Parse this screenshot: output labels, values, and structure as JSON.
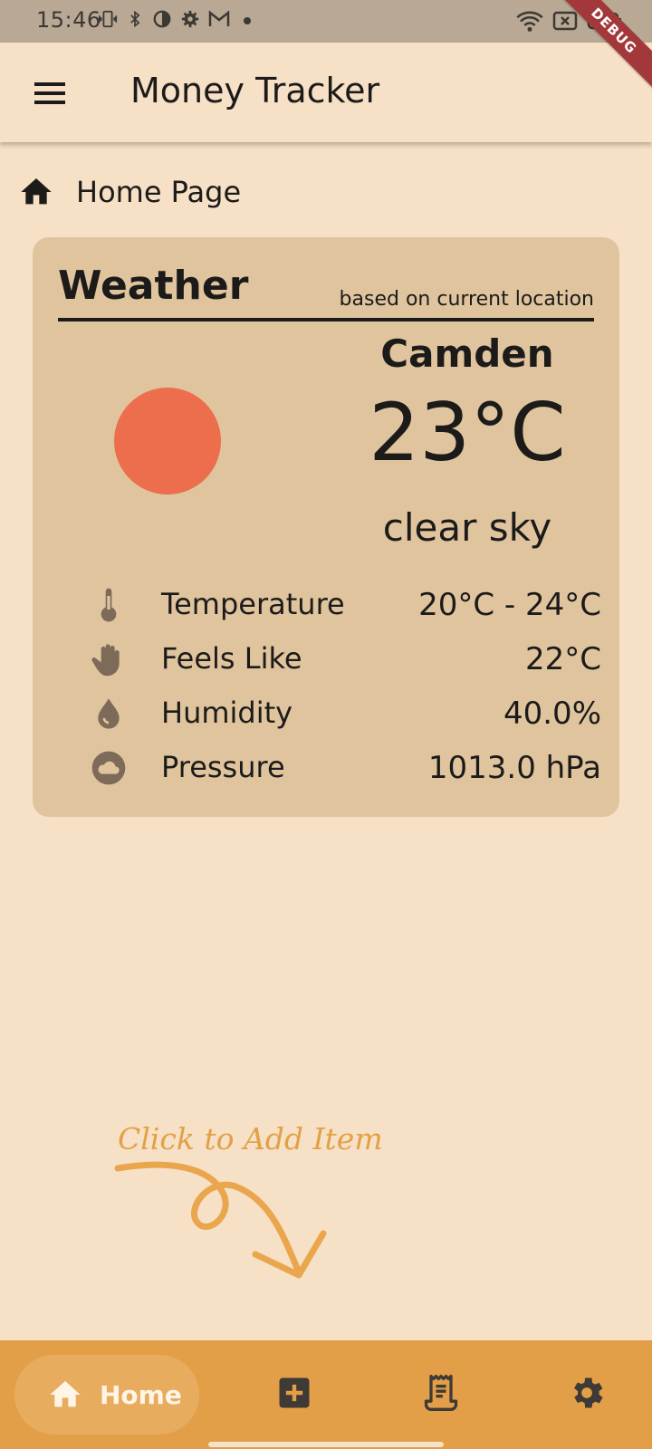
{
  "status_bar": {
    "time": "15:46",
    "debug_label": "DEBUG"
  },
  "app_bar": {
    "title": "Money Tracker",
    "menu_icon": "hamburger-menu-icon"
  },
  "breadcrumb": {
    "icon": "home-icon",
    "label": "Home Page"
  },
  "weather": {
    "heading": "Weather",
    "subheading": "based on current location",
    "city": "Camden",
    "temperature": "23°C",
    "description": "clear sky",
    "condition_icon": "sun-icon",
    "sun_color": "#ec6e4c",
    "details": [
      {
        "icon": "thermometer-icon",
        "label": "Temperature",
        "value": "20°C - 24°C"
      },
      {
        "icon": "hand-icon",
        "label": "Feels Like",
        "value": "22°C"
      },
      {
        "icon": "water-drop-icon",
        "label": "Humidity",
        "value": "40.0%"
      },
      {
        "icon": "cloud-icon",
        "label": "Pressure",
        "value": "1013.0 hPa"
      }
    ]
  },
  "hint": {
    "text": "Click to Add Item"
  },
  "bottom_nav": {
    "home_label": "Home",
    "items": [
      "home-icon",
      "add-box-icon",
      "receipt-icon",
      "settings-gear-icon"
    ]
  },
  "colors": {
    "background": "#f6e0c6",
    "card": "#dfc49e",
    "nav_accent": "#e39f47",
    "debug_ribbon": "#a3383a"
  }
}
